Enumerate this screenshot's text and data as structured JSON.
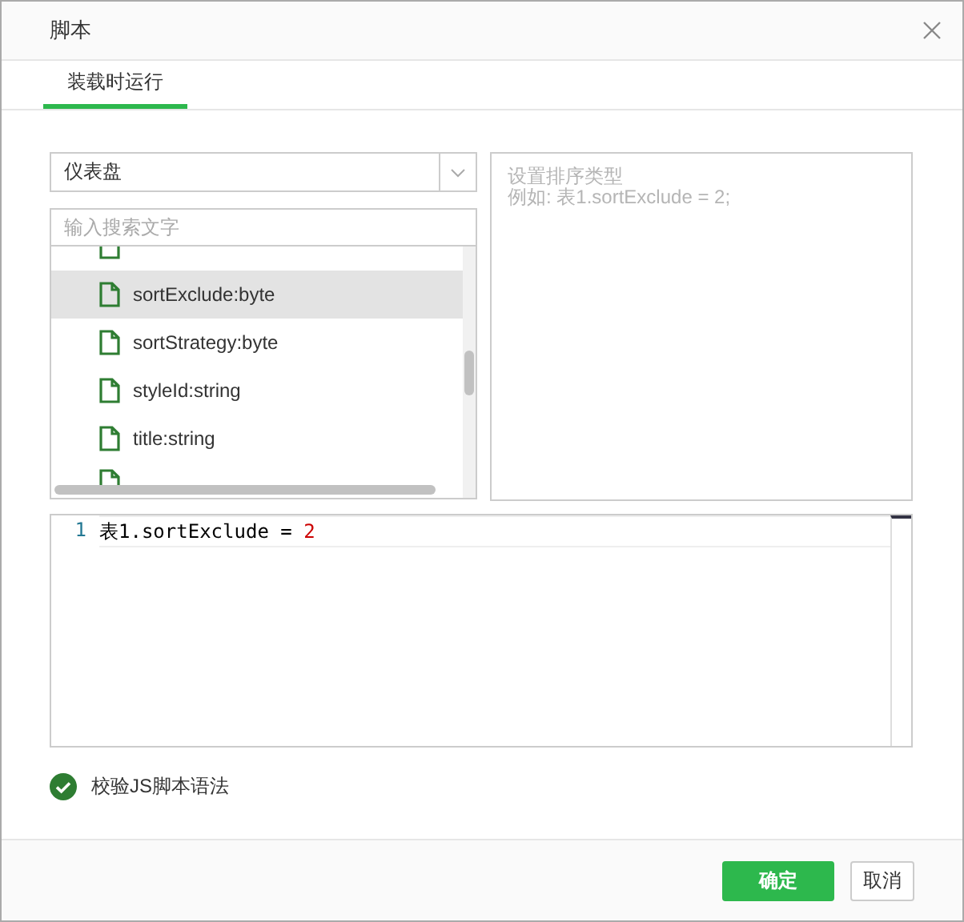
{
  "window": {
    "title": "脚本"
  },
  "tabs": [
    {
      "label": "装载时运行",
      "selected": true
    }
  ],
  "object_select": {
    "value": "仪表盘"
  },
  "search": {
    "placeholder": "输入搜索文字"
  },
  "properties": [
    {
      "label": "sortExclude:byte",
      "selected": true
    },
    {
      "label": "sortStrategy:byte",
      "selected": false
    },
    {
      "label": "styleId:string",
      "selected": false
    },
    {
      "label": "title:string",
      "selected": false
    }
  ],
  "hint": {
    "lines": [
      "设置排序类型",
      "例如: 表1.sortExclude = 2;"
    ]
  },
  "editor": {
    "lines": [
      {
        "number": "1",
        "object": "表",
        "rest": "1.sortExclude = ",
        "value": "2"
      }
    ]
  },
  "validate": {
    "label": "校验JS脚本语法",
    "checked": true
  },
  "buttons": [
    {
      "label": "确定",
      "kind": "primary"
    },
    {
      "label": "取消",
      "kind": "secondary"
    }
  ]
}
